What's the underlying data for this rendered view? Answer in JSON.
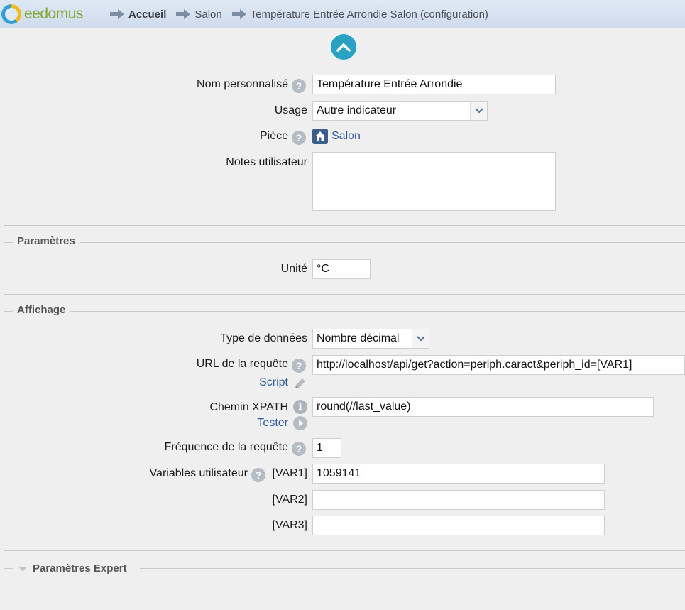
{
  "app": {
    "brand": "eedomus"
  },
  "breadcrumb": {
    "items": [
      {
        "label": "Accueil"
      },
      {
        "label": "Salon"
      },
      {
        "label": "Température Entrée Arrondie Salon (configuration)"
      }
    ]
  },
  "general": {
    "name_label": "Nom personnalisé",
    "name_value": "Température Entrée Arrondie",
    "usage_label": "Usage",
    "usage_value": "Autre indicateur",
    "room_label": "Pièce",
    "room_value": "Salon",
    "notes_label": "Notes utilisateur",
    "notes_value": ""
  },
  "parametres": {
    "legend": "Paramètres",
    "unit_label": "Unité",
    "unit_value": "°C"
  },
  "affichage": {
    "legend": "Affichage",
    "datatype_label": "Type de données",
    "datatype_value": "Nombre décimal",
    "url_label": "URL de la requête",
    "url_value": "http://localhost/api/get?action=periph.caract&periph_id=[VAR1]",
    "script_link": "Script",
    "xpath_label": "Chemin XPATH",
    "xpath_value": "round(//last_value)",
    "tester_link": "Tester",
    "freq_label": "Fréquence de la requête",
    "freq_value": "1",
    "vars_label": "Variables utilisateur",
    "var1_label": "[VAR1]",
    "var1_value": "1059141",
    "var2_label": "[VAR2]",
    "var2_value": "",
    "var3_label": "[VAR3]",
    "var3_value": ""
  },
  "expert": {
    "legend": "Paramètres Expert"
  },
  "colors": {
    "accent": "#2aa1c2",
    "link": "#2f5b9a",
    "brand_green": "#7fa72d"
  }
}
